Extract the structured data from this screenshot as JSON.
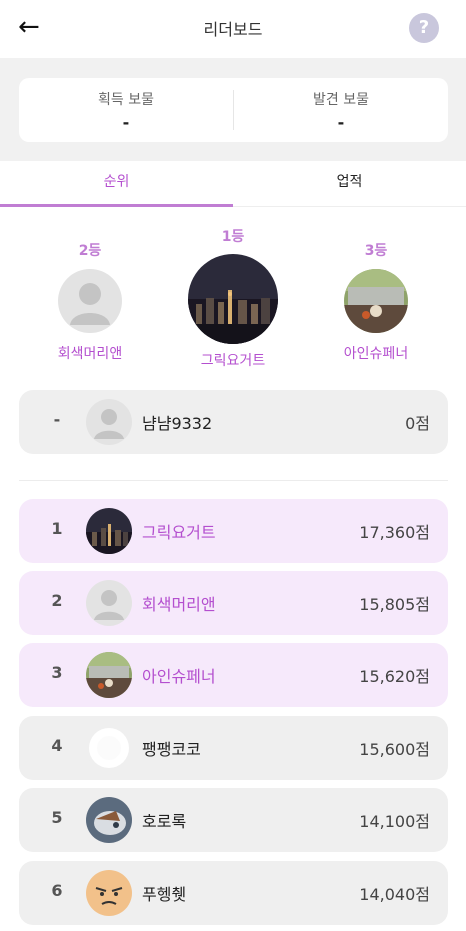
{
  "header": {
    "back_icon": "←",
    "title": "리더보드",
    "help_icon": "?"
  },
  "stats": [
    {
      "label": "획득 보물",
      "value": "-"
    },
    {
      "label": "발견 보물",
      "value": "-"
    }
  ],
  "tabs": [
    {
      "label": "순위",
      "active": true
    },
    {
      "label": "업적",
      "active": false
    }
  ],
  "podium": {
    "first": {
      "rank": "1등",
      "name": "그릭요거트"
    },
    "second": {
      "rank": "2등",
      "name": "회색머리앤"
    },
    "third": {
      "rank": "3등",
      "name": "아인슈페너"
    }
  },
  "my_rank": {
    "rank": "-",
    "name": "냠냠9332",
    "score": "0점"
  },
  "leaderboard": [
    {
      "rank": "1",
      "name": "그릭요거트",
      "score": "17,360점"
    },
    {
      "rank": "2",
      "name": "회색머리앤",
      "score": "15,805점"
    },
    {
      "rank": "3",
      "name": "아인슈페너",
      "score": "15,620점"
    },
    {
      "rank": "4",
      "name": "팽팽코코",
      "score": "15,600점"
    },
    {
      "rank": "5",
      "name": "호로록",
      "score": "14,100점"
    },
    {
      "rank": "6",
      "name": "푸헹췟",
      "score": "14,040점"
    }
  ],
  "colors": {
    "accent": "#b44fcf",
    "top3_bg": "#f6e9fb",
    "row_bg": "#efefef",
    "band_bg": "#f1f1f1"
  }
}
